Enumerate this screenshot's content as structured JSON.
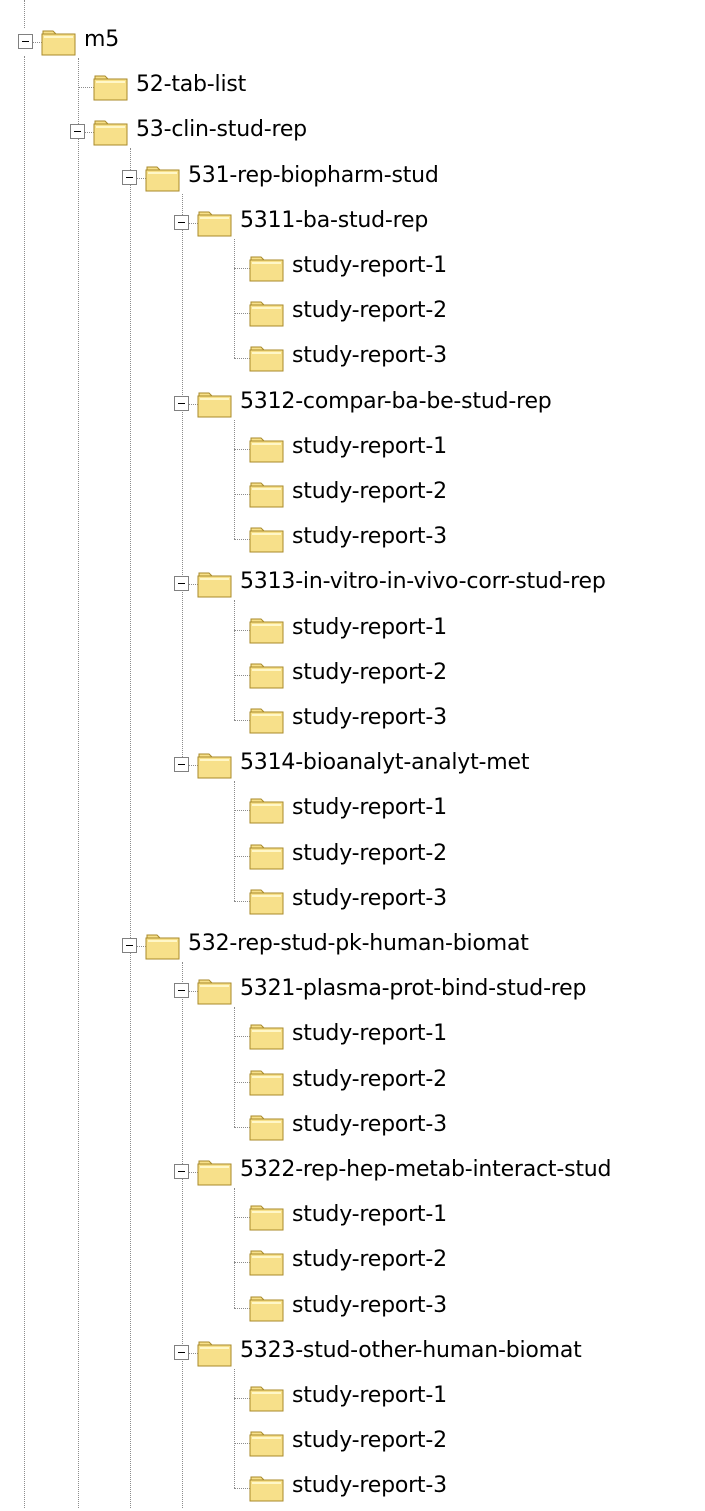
{
  "tree": [
    {
      "label": "m5",
      "depth": 0,
      "expanded": true,
      "icon": "folder-icon"
    },
    {
      "label": "52-tab-list",
      "depth": 1,
      "expanded": false,
      "icon": "folder-icon"
    },
    {
      "label": "53-clin-stud-rep",
      "depth": 1,
      "expanded": true,
      "icon": "folder-icon"
    },
    {
      "label": "531-rep-biopharm-stud",
      "depth": 2,
      "expanded": true,
      "icon": "folder-icon"
    },
    {
      "label": "5311-ba-stud-rep",
      "depth": 3,
      "expanded": true,
      "icon": "folder-icon"
    },
    {
      "label": "study-report-1",
      "depth": 4,
      "expanded": false,
      "icon": "folder-icon"
    },
    {
      "label": "study-report-2",
      "depth": 4,
      "expanded": false,
      "icon": "folder-icon"
    },
    {
      "label": "study-report-3",
      "depth": 4,
      "expanded": false,
      "icon": "folder-icon"
    },
    {
      "label": "5312-compar-ba-be-stud-rep",
      "depth": 3,
      "expanded": true,
      "icon": "folder-icon"
    },
    {
      "label": "study-report-1",
      "depth": 4,
      "expanded": false,
      "icon": "folder-icon"
    },
    {
      "label": "study-report-2",
      "depth": 4,
      "expanded": false,
      "icon": "folder-icon"
    },
    {
      "label": "study-report-3",
      "depth": 4,
      "expanded": false,
      "icon": "folder-icon"
    },
    {
      "label": "5313-in-vitro-in-vivo-corr-stud-rep",
      "depth": 3,
      "expanded": true,
      "icon": "folder-icon"
    },
    {
      "label": "study-report-1",
      "depth": 4,
      "expanded": false,
      "icon": "folder-icon"
    },
    {
      "label": "study-report-2",
      "depth": 4,
      "expanded": false,
      "icon": "folder-icon"
    },
    {
      "label": "study-report-3",
      "depth": 4,
      "expanded": false,
      "icon": "folder-icon"
    },
    {
      "label": "5314-bioanalyt-analyt-met",
      "depth": 3,
      "expanded": true,
      "icon": "folder-icon"
    },
    {
      "label": "study-report-1",
      "depth": 4,
      "expanded": false,
      "icon": "folder-icon"
    },
    {
      "label": "study-report-2",
      "depth": 4,
      "expanded": false,
      "icon": "folder-icon"
    },
    {
      "label": "study-report-3",
      "depth": 4,
      "expanded": false,
      "icon": "folder-icon"
    },
    {
      "label": "532-rep-stud-pk-human-biomat",
      "depth": 2,
      "expanded": true,
      "icon": "folder-icon"
    },
    {
      "label": "5321-plasma-prot-bind-stud-rep",
      "depth": 3,
      "expanded": true,
      "icon": "folder-icon"
    },
    {
      "label": "study-report-1",
      "depth": 4,
      "expanded": false,
      "icon": "folder-icon"
    },
    {
      "label": "study-report-2",
      "depth": 4,
      "expanded": false,
      "icon": "folder-icon"
    },
    {
      "label": "study-report-3",
      "depth": 4,
      "expanded": false,
      "icon": "folder-icon"
    },
    {
      "label": "5322-rep-hep-metab-interact-stud",
      "depth": 3,
      "expanded": true,
      "icon": "folder-icon"
    },
    {
      "label": "study-report-1",
      "depth": 4,
      "expanded": false,
      "icon": "folder-icon"
    },
    {
      "label": "study-report-2",
      "depth": 4,
      "expanded": false,
      "icon": "folder-icon"
    },
    {
      "label": "study-report-3",
      "depth": 4,
      "expanded": false,
      "icon": "folder-icon"
    },
    {
      "label": "5323-stud-other-human-biomat",
      "depth": 3,
      "expanded": true,
      "icon": "folder-icon"
    },
    {
      "label": "study-report-1",
      "depth": 4,
      "expanded": false,
      "icon": "folder-icon"
    },
    {
      "label": "study-report-2",
      "depth": 4,
      "expanded": false,
      "icon": "folder-icon"
    },
    {
      "label": "study-report-3",
      "depth": 4,
      "expanded": false,
      "icon": "folder-icon"
    }
  ],
  "colors": {
    "folder_fill": "#f7e08a",
    "folder_edge": "#a88a2a",
    "guide_line": "#8c8c8c"
  }
}
